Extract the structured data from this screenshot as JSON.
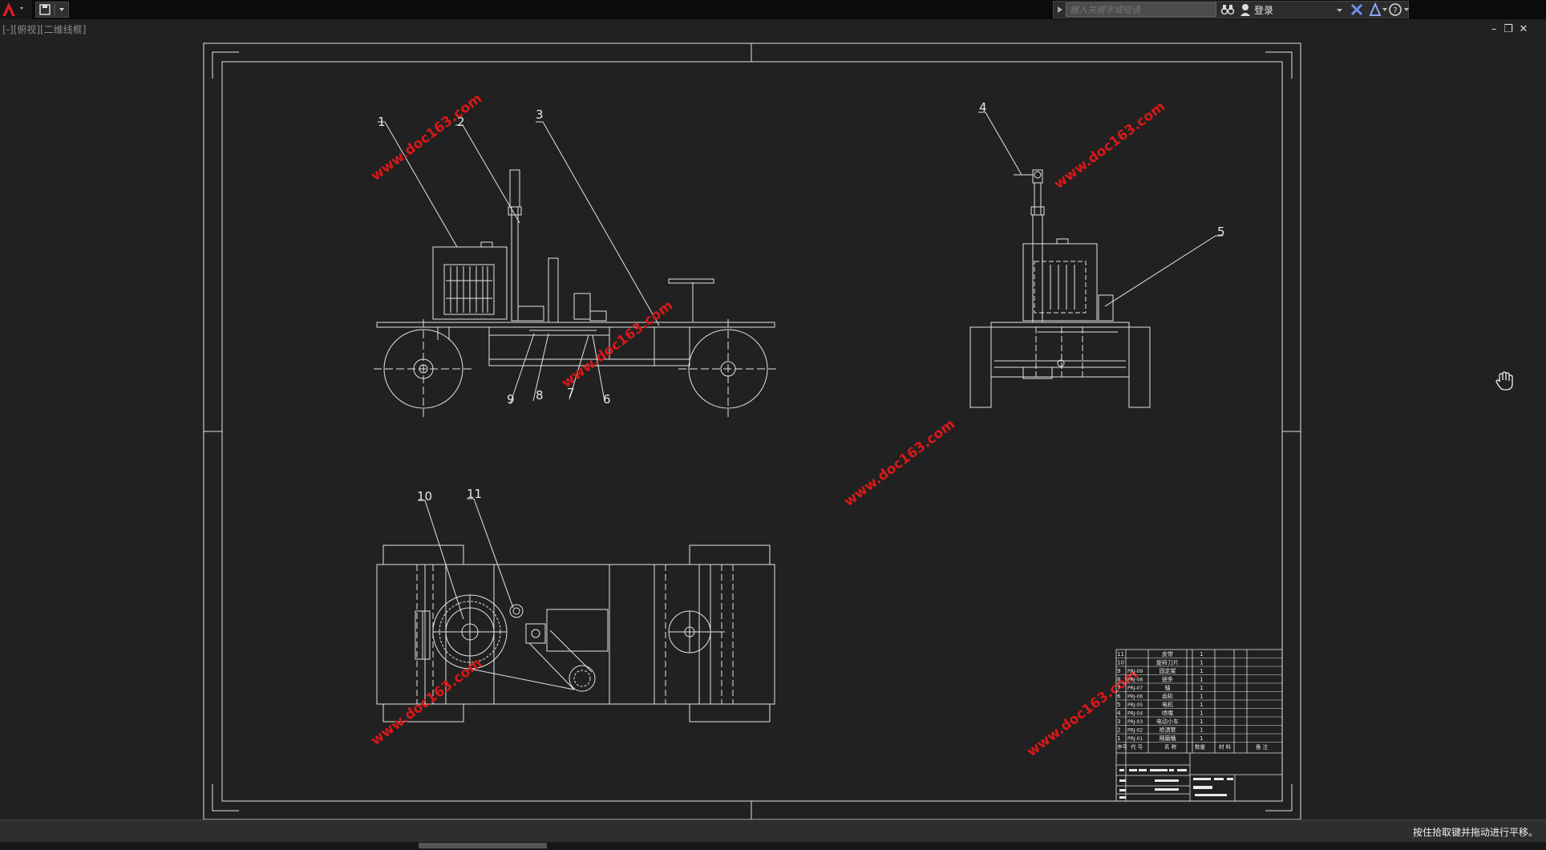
{
  "app": {
    "search_placeholder": "键入关键字或短语",
    "login_label": "登录",
    "viewport_label": "[-][俯视][二维线框]",
    "status_text": "按住拾取键并拖动进行平移。"
  },
  "icons": {
    "app_menu": "autocad-a-icon",
    "quick_access": "save-icon",
    "binoculars": "binoculars-icon",
    "user": "user-icon",
    "exchange": "exchange-icon",
    "a360": "a360-icon",
    "help": "help-icon",
    "pan_cursor": "hand-pan-cursor-icon"
  },
  "colors": {
    "background": "#212121",
    "line": "#e8e8e8",
    "watermark": "#d81818"
  },
  "drawing": {
    "part_labels": [
      "1",
      "2",
      "3",
      "4",
      "5",
      "6",
      "7",
      "8",
      "9",
      "10",
      "11"
    ],
    "watermark": "www.doc163.com",
    "bom": {
      "rows": [
        {
          "no": "11",
          "code": "",
          "name": "皮带",
          "qty": "1"
        },
        {
          "no": "10",
          "code": "",
          "name": "旋转刀片",
          "qty": "1"
        },
        {
          "no": "9",
          "code": "PRJ-09",
          "name": "固定架",
          "qty": "1"
        },
        {
          "no": "8",
          "code": "PRJ-08",
          "name": "链条",
          "qty": "1"
        },
        {
          "no": "7",
          "code": "PRJ-07",
          "name": "轴",
          "qty": "1"
        },
        {
          "no": "6",
          "code": "PRJ-06",
          "name": "齿轮",
          "qty": "1"
        },
        {
          "no": "5",
          "code": "PRJ-05",
          "name": "电机",
          "qty": "1"
        },
        {
          "no": "4",
          "code": "PRJ-04",
          "name": "喷嘴",
          "qty": "1"
        },
        {
          "no": "3",
          "code": "PRJ-03",
          "name": "电动小车",
          "qty": "1"
        },
        {
          "no": "2",
          "code": "PRJ-02",
          "name": "喷洒管",
          "qty": "1"
        },
        {
          "no": "1",
          "code": "PRJ-01",
          "name": "隔磨桶",
          "qty": "1"
        }
      ],
      "header": [
        "序号",
        "代 号",
        "名 称",
        "数量",
        "材 料",
        "备 注"
      ]
    }
  }
}
